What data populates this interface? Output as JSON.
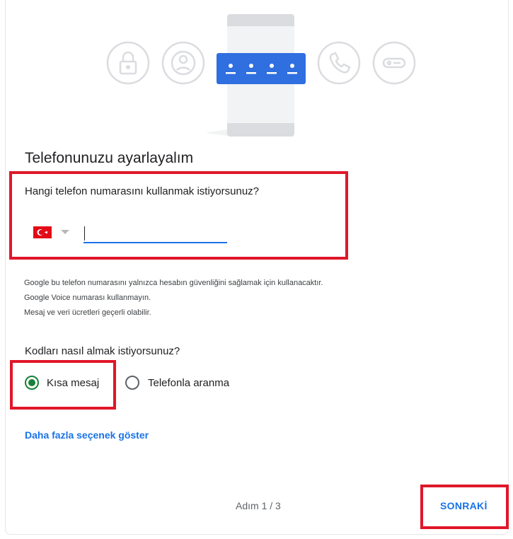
{
  "page": {
    "title": "Telefonunuzu ayarlayalım"
  },
  "illustration": {
    "icons": [
      "lock-icon",
      "account-icon",
      "password-dots-icon",
      "phone-call-icon",
      "key-icon"
    ],
    "password_mask": "••••"
  },
  "phone": {
    "question": "Hangi telefon numarasını kullanmak istiyorsunuz?",
    "country_flag": "turkey-flag-icon",
    "number_value": "",
    "number_placeholder": ""
  },
  "info": {
    "lines": [
      "Google bu telefon numarasını yalnızca hesabın güvenliğini sağlamak için kullanacaktır.",
      "Google Voice numarası kullanmayın.",
      "Mesaj ve veri ücretleri geçerli olabilir."
    ]
  },
  "delivery": {
    "question": "Kodları nasıl almak istiyorsunuz?",
    "options": [
      {
        "label": "Kısa mesaj",
        "selected": true
      },
      {
        "label": "Telefonla aranma",
        "selected": false
      }
    ]
  },
  "more_options": "Daha fazla seçenek göster",
  "footer": {
    "step": "Adım 1 / 3",
    "next": "SONRAKİ"
  },
  "colors": {
    "accent": "#1a73e8",
    "radio_selected": "#188038",
    "highlight_box": "#e0172a"
  }
}
